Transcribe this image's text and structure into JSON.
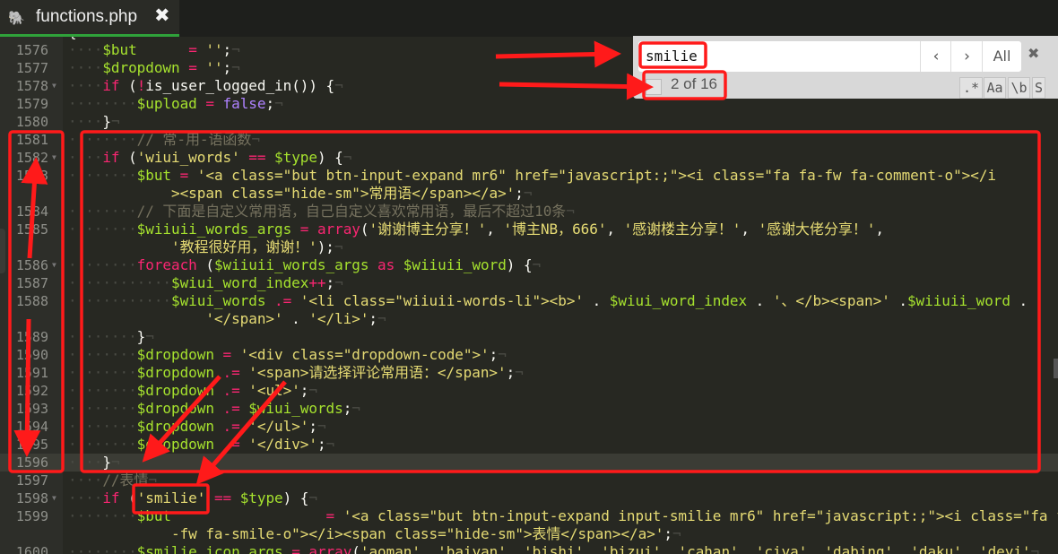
{
  "tab": {
    "title": "functions.php",
    "icon": "php-elephant-icon",
    "close": "✖"
  },
  "find": {
    "query": "smilie",
    "prev": "‹",
    "next": "›",
    "all": "All",
    "close": "✖",
    "count": "2 of 16",
    "options": [
      ".*",
      "Aa",
      "\\b",
      "S"
    ]
  },
  "colors": {
    "keyword": "#f92672",
    "variable": "#a6e22e",
    "string": "#e6db74",
    "comment": "#75715e",
    "constant": "#ae81ff",
    "annotation": "#ff1a1a",
    "tab_underline": "#2fa23a"
  },
  "code": [
    {
      "n": "1575",
      "i": 0,
      "t": [
        [
          "p",
          "{"
        ]
      ]
    },
    {
      "n": "1576",
      "i": 4,
      "t": [
        [
          "v",
          "$but"
        ],
        [
          "p",
          "      "
        ],
        [
          "o",
          "="
        ],
        [
          "p",
          " "
        ],
        [
          "s",
          "''"
        ],
        [
          "p",
          ";"
        ]
      ]
    },
    {
      "n": "1577",
      "i": 4,
      "t": [
        [
          "v",
          "$dropdown"
        ],
        [
          "p",
          " "
        ],
        [
          "o",
          "="
        ],
        [
          "p",
          " "
        ],
        [
          "s",
          "''"
        ],
        [
          "p",
          ";"
        ]
      ]
    },
    {
      "n": "1578",
      "i": 4,
      "fold": true,
      "t": [
        [
          "k",
          "if"
        ],
        [
          "p",
          " ("
        ],
        [
          "o",
          "!"
        ],
        [
          "p",
          "is_user_logged_in()) {"
        ]
      ]
    },
    {
      "n": "1579",
      "i": 8,
      "t": [
        [
          "v",
          "$upload"
        ],
        [
          "p",
          " "
        ],
        [
          "o",
          "="
        ],
        [
          "p",
          " "
        ],
        [
          "n",
          "false"
        ],
        [
          "p",
          ";"
        ]
      ]
    },
    {
      "n": "1580",
      "i": 4,
      "t": [
        [
          "p",
          "}"
        ]
      ]
    },
    {
      "n": "1581",
      "i": 8,
      "t": [
        [
          "c",
          "// 常-用-语函数"
        ]
      ]
    },
    {
      "n": "1582",
      "i": 4,
      "fold": true,
      "t": [
        [
          "k",
          "if"
        ],
        [
          "p",
          " ("
        ],
        [
          "s",
          "'wiui_words'"
        ],
        [
          "p",
          " "
        ],
        [
          "o",
          "=="
        ],
        [
          "p",
          " "
        ],
        [
          "v",
          "$type"
        ],
        [
          "p",
          ") {"
        ]
      ]
    },
    {
      "n": "1583",
      "i": 8,
      "t": [
        [
          "v",
          "$but"
        ],
        [
          "p",
          " "
        ],
        [
          "o",
          "="
        ],
        [
          "p",
          " "
        ],
        [
          "s",
          "'<a class=\"but btn-input-expand mr6\" href=\"javascript:;\"><i class=\"fa fa-fw fa-comment-o\"></i"
        ]
      ]
    },
    {
      "n": "",
      "i": 12,
      "t": [
        [
          "s",
          "><span class=\"hide-sm\">常用语</span></a>'"
        ],
        [
          "p",
          ";"
        ]
      ]
    },
    {
      "n": "1584",
      "i": 8,
      "t": [
        [
          "c",
          "// 下面是自定义常用语，自己自定义喜欢常用语，最后不超过10条"
        ]
      ]
    },
    {
      "n": "1585",
      "i": 8,
      "t": [
        [
          "v",
          "$wiiuii_words_args"
        ],
        [
          "p",
          " "
        ],
        [
          "o",
          "="
        ],
        [
          "p",
          " "
        ],
        [
          "k",
          "array"
        ],
        [
          "p",
          "("
        ],
        [
          "s",
          "'谢谢博主分享！'"
        ],
        [
          "p",
          ", "
        ],
        [
          "s",
          "'博主NB，666'"
        ],
        [
          "p",
          ", "
        ],
        [
          "s",
          "'感谢楼主分享！'"
        ],
        [
          "p",
          ", "
        ],
        [
          "s",
          "'感谢大佬分享！'"
        ],
        [
          "p",
          ","
        ]
      ]
    },
    {
      "n": "",
      "i": 12,
      "t": [
        [
          "s",
          "'教程很好用，谢谢！'"
        ],
        [
          "p",
          ");"
        ]
      ]
    },
    {
      "n": "1586",
      "i": 8,
      "fold": true,
      "t": [
        [
          "k",
          "foreach"
        ],
        [
          "p",
          " ("
        ],
        [
          "v",
          "$wiiuii_words_args"
        ],
        [
          "p",
          " "
        ],
        [
          "k",
          "as"
        ],
        [
          "p",
          " "
        ],
        [
          "v",
          "$wiiuii_word"
        ],
        [
          "p",
          ") {"
        ]
      ]
    },
    {
      "n": "1587",
      "i": 12,
      "t": [
        [
          "v",
          "$wiui_word_index"
        ],
        [
          "o",
          "++"
        ],
        [
          "p",
          ";"
        ]
      ]
    },
    {
      "n": "1588",
      "i": 12,
      "t": [
        [
          "v",
          "$wiui_words"
        ],
        [
          "p",
          " "
        ],
        [
          "o",
          ".="
        ],
        [
          "p",
          " "
        ],
        [
          "s",
          "'<li class=\"wiiuii-words-li\"><b>'"
        ],
        [
          "p",
          " . "
        ],
        [
          "v",
          "$wiui_word_index"
        ],
        [
          "p",
          " . "
        ],
        [
          "s",
          "'、</b><span>'"
        ],
        [
          "p",
          " ."
        ],
        [
          "v",
          "$wiiuii_word"
        ],
        [
          "p",
          " ."
        ]
      ]
    },
    {
      "n": "",
      "i": 16,
      "t": [
        [
          "s",
          "'</span>'"
        ],
        [
          "p",
          " . "
        ],
        [
          "s",
          "'</li>'"
        ],
        [
          "p",
          ";"
        ]
      ]
    },
    {
      "n": "1589",
      "i": 8,
      "t": [
        [
          "p",
          "}"
        ]
      ]
    },
    {
      "n": "1590",
      "i": 8,
      "t": [
        [
          "v",
          "$dropdown"
        ],
        [
          "p",
          " "
        ],
        [
          "o",
          "="
        ],
        [
          "p",
          " "
        ],
        [
          "s",
          "'<div class=\"dropdown-code\">'"
        ],
        [
          "p",
          ";"
        ]
      ]
    },
    {
      "n": "1591",
      "i": 8,
      "t": [
        [
          "v",
          "$dropdown"
        ],
        [
          "p",
          " "
        ],
        [
          "o",
          ".="
        ],
        [
          "p",
          " "
        ],
        [
          "s",
          "'<span>请选择评论常用语：</span>'"
        ],
        [
          "p",
          ";"
        ]
      ]
    },
    {
      "n": "1592",
      "i": 8,
      "t": [
        [
          "v",
          "$dropdown"
        ],
        [
          "p",
          " "
        ],
        [
          "o",
          ".="
        ],
        [
          "p",
          " "
        ],
        [
          "s",
          "'<ul>'"
        ],
        [
          "p",
          ";"
        ]
      ]
    },
    {
      "n": "1593",
      "i": 8,
      "t": [
        [
          "v",
          "$dropdown"
        ],
        [
          "p",
          " "
        ],
        [
          "o",
          ".="
        ],
        [
          "p",
          " "
        ],
        [
          "v",
          "$wiui_words"
        ],
        [
          "p",
          ";"
        ]
      ]
    },
    {
      "n": "1594",
      "i": 8,
      "t": [
        [
          "v",
          "$dropdown"
        ],
        [
          "p",
          " "
        ],
        [
          "o",
          ".="
        ],
        [
          "p",
          " "
        ],
        [
          "s",
          "'</ul>'"
        ],
        [
          "p",
          ";"
        ]
      ]
    },
    {
      "n": "1595",
      "i": 8,
      "t": [
        [
          "v",
          "$dropdown"
        ],
        [
          "p",
          " "
        ],
        [
          "o",
          ".="
        ],
        [
          "p",
          " "
        ],
        [
          "s",
          "'</div>'"
        ],
        [
          "p",
          ";"
        ]
      ]
    },
    {
      "n": "1596",
      "i": 4,
      "cur": true,
      "t": [
        [
          "p",
          "}"
        ]
      ]
    },
    {
      "n": "1597",
      "i": 4,
      "t": [
        [
          "c",
          "//表情"
        ]
      ]
    },
    {
      "n": "1598",
      "i": 4,
      "fold": true,
      "t": [
        [
          "k",
          "if"
        ],
        [
          "p",
          " ("
        ],
        [
          "s",
          "'smilie'"
        ],
        [
          "p",
          " "
        ],
        [
          "o",
          "=="
        ],
        [
          "p",
          " "
        ],
        [
          "v",
          "$type"
        ],
        [
          "p",
          ") {"
        ]
      ]
    },
    {
      "n": "1599",
      "i": 8,
      "t": [
        [
          "v",
          "$but"
        ],
        [
          "p",
          "                  "
        ],
        [
          "o",
          "="
        ],
        [
          "p",
          " "
        ],
        [
          "s",
          "'<a class=\"but btn-input-expand input-smilie mr6\" href=\"javascript:;\"><i class=\"fa fa"
        ]
      ]
    },
    {
      "n": "",
      "i": 12,
      "t": [
        [
          "s",
          "-fw fa-smile-o\"></i><span class=\"hide-sm\">表情</span></a>'"
        ],
        [
          "p",
          ";"
        ]
      ]
    },
    {
      "n": "1600",
      "i": 8,
      "t": [
        [
          "v",
          "$smilie_icon_args"
        ],
        [
          "p",
          " "
        ],
        [
          "o",
          "="
        ],
        [
          "p",
          " "
        ],
        [
          "k",
          "array"
        ],
        [
          "p",
          "("
        ],
        [
          "s",
          "'aoman'"
        ],
        [
          "p",
          ", "
        ],
        [
          "s",
          "'baiyan'"
        ],
        [
          "p",
          ", "
        ],
        [
          "s",
          "'bishi'"
        ],
        [
          "p",
          ", "
        ],
        [
          "s",
          "'bizui'"
        ],
        [
          "p",
          ", "
        ],
        [
          "s",
          "'cahan'"
        ],
        [
          "p",
          ", "
        ],
        [
          "s",
          "'ciya'"
        ],
        [
          "p",
          ", "
        ],
        [
          "s",
          "'dabing'"
        ],
        [
          "p",
          ", "
        ],
        [
          "s",
          "'daku'"
        ],
        [
          "p",
          ", "
        ],
        [
          "s",
          "'deyi'"
        ]
      ]
    }
  ]
}
